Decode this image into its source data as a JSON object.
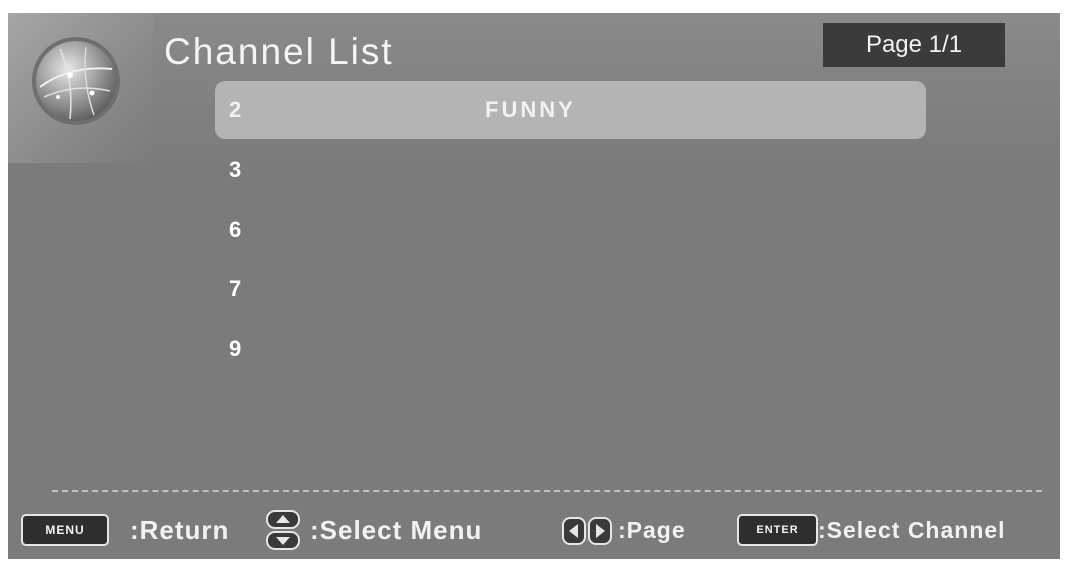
{
  "header": {
    "title": "Channel List",
    "page_indicator": "Page 1/1"
  },
  "channels": [
    {
      "number": "2",
      "name": "FUNNY",
      "selected": true
    },
    {
      "number": "3",
      "name": "",
      "selected": false
    },
    {
      "number": "6",
      "name": "",
      "selected": false
    },
    {
      "number": "7",
      "name": "",
      "selected": false
    },
    {
      "number": "9",
      "name": "",
      "selected": false
    }
  ],
  "footer": {
    "menu_key": "MENU",
    "menu_hint": ":Return",
    "updown_icon": "up-down-arrows-icon",
    "updown_hint": ":Select Menu",
    "leftright_icon": "left-right-arrows-icon",
    "leftright_hint": ":Page",
    "enter_key": "ENTER",
    "enter_hint": ":Select Channel"
  },
  "colors": {
    "background": "#7b7b7b",
    "selected_row": "#b4b4b4",
    "page_box": "#3b3b3b",
    "text": "#f4f4f4"
  }
}
